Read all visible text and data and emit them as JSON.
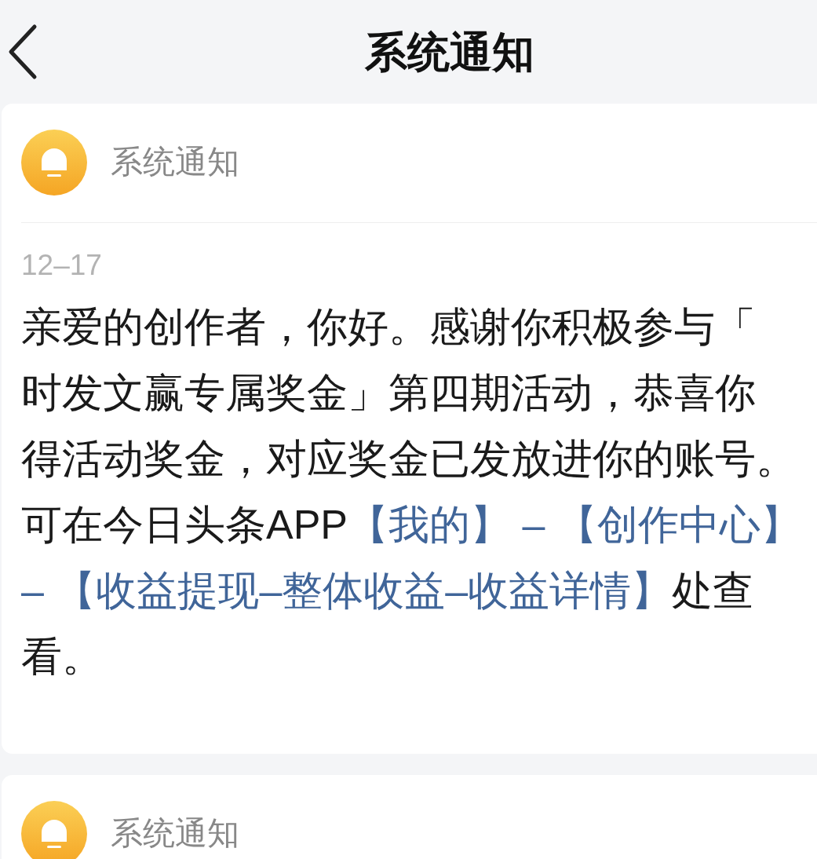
{
  "header": {
    "title": "系统通知"
  },
  "notifications": [
    {
      "sender": "系统通知",
      "date": "12–17",
      "segments": [
        {
          "kind": "plain",
          "text": "亲爱的创作者，你好。感谢你积极参与「"
        },
        {
          "kind": "break"
        },
        {
          "kind": "plain",
          "text": "时发文赢专属奖金」第四期活动，恭喜你"
        },
        {
          "kind": "break"
        },
        {
          "kind": "plain",
          "text": "得活动奖金，对应奖金已发放进你的账号。"
        },
        {
          "kind": "break"
        },
        {
          "kind": "plain",
          "text": "可在今日头条APP"
        },
        {
          "kind": "link",
          "text": "【我的】"
        },
        {
          "kind": "separator",
          "text": " – "
        },
        {
          "kind": "link",
          "text": "【创作中心】"
        },
        {
          "kind": "break"
        },
        {
          "kind": "separator",
          "text": "– "
        },
        {
          "kind": "link",
          "text": "【收益提现–整体收益–收益详情】"
        },
        {
          "kind": "plain",
          "text": "处查"
        },
        {
          "kind": "break"
        },
        {
          "kind": "plain",
          "text": "看。"
        }
      ]
    },
    {
      "sender": "系统通知"
    }
  ]
}
